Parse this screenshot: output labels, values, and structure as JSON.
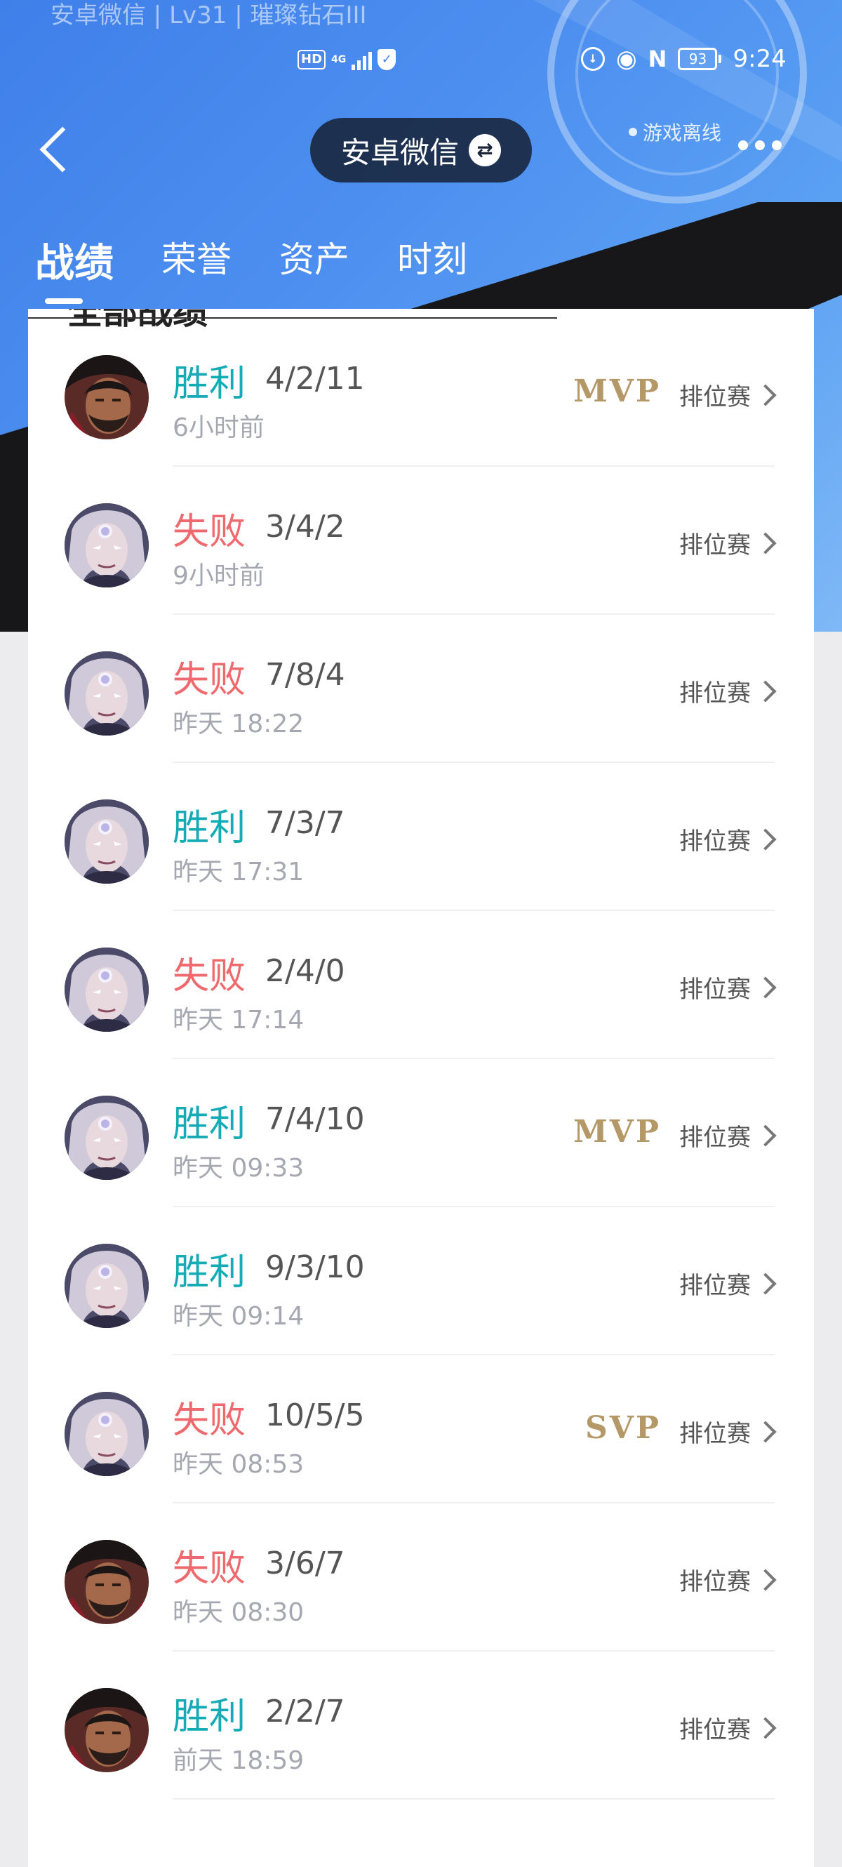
{
  "header": {
    "subtitle": "安卓微信 | Lv31 | 璀璨钻石III",
    "title": "安卓微信",
    "status": "游戏离线"
  },
  "status_bar": {
    "hd": "HD",
    "net": "4G",
    "nfc": "N",
    "battery": "93",
    "time": "9:24"
  },
  "tabs": [
    {
      "label": "战绩",
      "active": true
    },
    {
      "label": "荣誉",
      "active": false
    },
    {
      "label": "资产",
      "active": false
    },
    {
      "label": "时刻",
      "active": false
    }
  ],
  "section": {
    "title": "全部战绩"
  },
  "records": [
    {
      "result": "胜利",
      "outcome": "win",
      "kda": "4/2/11",
      "time": "6小时前",
      "badge": "MVP",
      "mode": "排位赛",
      "hero": "dark-hair-hero"
    },
    {
      "result": "失败",
      "outcome": "lose",
      "kda": "3/4/2",
      "time": "9小时前",
      "badge": "",
      "mode": "排位赛",
      "hero": "silver-hair-hero"
    },
    {
      "result": "失败",
      "outcome": "lose",
      "kda": "7/8/4",
      "time": "昨天 18:22",
      "badge": "",
      "mode": "排位赛",
      "hero": "silver-hair-hero"
    },
    {
      "result": "胜利",
      "outcome": "win",
      "kda": "7/3/7",
      "time": "昨天 17:31",
      "badge": "",
      "mode": "排位赛",
      "hero": "silver-hair-hero"
    },
    {
      "result": "失败",
      "outcome": "lose",
      "kda": "2/4/0",
      "time": "昨天 17:14",
      "badge": "",
      "mode": "排位赛",
      "hero": "silver-hair-hero"
    },
    {
      "result": "胜利",
      "outcome": "win",
      "kda": "7/4/10",
      "time": "昨天 09:33",
      "badge": "MVP",
      "mode": "排位赛",
      "hero": "silver-hair-hero"
    },
    {
      "result": "胜利",
      "outcome": "win",
      "kda": "9/3/10",
      "time": "昨天 09:14",
      "badge": "",
      "mode": "排位赛",
      "hero": "silver-hair-hero"
    },
    {
      "result": "失败",
      "outcome": "lose",
      "kda": "10/5/5",
      "time": "昨天 08:53",
      "badge": "SVP",
      "mode": "排位赛",
      "hero": "silver-hair-hero"
    },
    {
      "result": "失败",
      "outcome": "lose",
      "kda": "3/6/7",
      "time": "昨天 08:30",
      "badge": "",
      "mode": "排位赛",
      "hero": "dark-hair-hero"
    },
    {
      "result": "胜利",
      "outcome": "win",
      "kda": "2/2/7",
      "time": "前天 18:59",
      "badge": "",
      "mode": "排位赛",
      "hero": "dark-hair-hero"
    }
  ],
  "colors": {
    "win": "#14aab6",
    "lose": "#ee6a6e",
    "badge": "#b49868",
    "accent": "#3f7fe9"
  }
}
